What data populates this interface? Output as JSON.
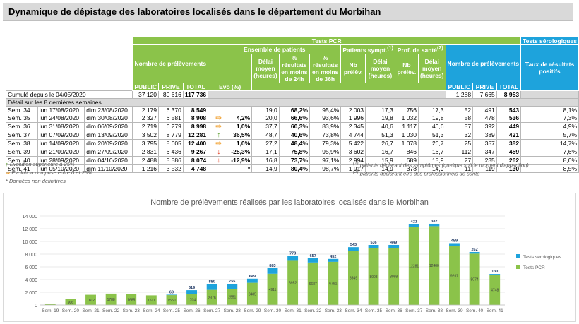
{
  "title": "Dynamique de dépistage des laboratoires localisés dans le département du Morbihan",
  "table": {
    "pcr_header": "Tests PCR",
    "sero_header": "Tests sérologiques",
    "nb_prel": "Nombre de prélèvements",
    "ensemble": "Ensemble de patients",
    "patients_sympt": "Patients sympt.",
    "prof_sante": "Prof. de santé",
    "sup1": "(1)",
    "sup2": "(2)",
    "delai_moyen": "Délai moyen (heures)",
    "pct24": "% résultats en moins de 24h",
    "pct36": "% résultats en moins de 36h",
    "nb_prelev": "Nb prélèv.",
    "taux": "Taux de résultats positifs",
    "public": "PUBLIC",
    "prive": "PRIVE",
    "total": "TOTAL",
    "evo": "Evo (%)",
    "cumul_label": "Cumulé depuis le 04/05/2020",
    "cumul": [
      "37 120",
      "80 616",
      "117 736",
      "1 288",
      "7 665",
      "8 953"
    ],
    "detail_label": "Détail sur les 8 dernières semaines",
    "rows": [
      {
        "sem": "Sem. 34",
        "du": "lun 17/08/2020",
        "au": "dim 23/08/2020",
        "pub": "2 179",
        "priv": "6 370",
        "tot": "8 549",
        "arrow": "",
        "evo": "",
        "delai": "19,0",
        "p24": "68,2%",
        "p36": "95,4%",
        "snb": "2 003",
        "sd": "17,3",
        "pnb": "756",
        "pd": "17,3",
        "spub": "52",
        "spriv": "491",
        "stot": "543",
        "taux": "8,1%"
      },
      {
        "sem": "Sem. 35",
        "du": "lun 24/08/2020",
        "au": "dim 30/08/2020",
        "pub": "2 327",
        "priv": "6 581",
        "tot": "8 908",
        "arrow": "mid",
        "evo": "4,2%",
        "delai": "20,0",
        "p24": "66,6%",
        "p36": "93,6%",
        "snb": "1 996",
        "sd": "19,8",
        "pnb": "1 032",
        "pd": "19,8",
        "spub": "58",
        "spriv": "478",
        "stot": "536",
        "taux": "7,3%"
      },
      {
        "sem": "Sem. 36",
        "du": "lun 31/08/2020",
        "au": "dim 06/09/2020",
        "pub": "2 719",
        "priv": "6 279",
        "tot": "8 998",
        "arrow": "mid",
        "evo": "1,0%",
        "delai": "37,7",
        "p24": "60,3%",
        "p36": "83,9%",
        "snb": "2 345",
        "sd": "40,6",
        "pnb": "1 117",
        "pd": "40,6",
        "spub": "57",
        "spriv": "392",
        "stot": "449",
        "taux": "4,9%"
      },
      {
        "sem": "Sem. 37",
        "du": "lun 07/09/2020",
        "au": "dim 13/09/2020",
        "pub": "3 502",
        "priv": "8 779",
        "tot": "12 281",
        "arrow": "up",
        "evo": "36,5%",
        "delai": "48,7",
        "p24": "40,6%",
        "p36": "73,8%",
        "snb": "4 744",
        "sd": "51,3",
        "pnb": "1 030",
        "pd": "51,3",
        "spub": "32",
        "spriv": "389",
        "stot": "421",
        "taux": "5,7%"
      },
      {
        "sem": "Sem. 38",
        "du": "lun 14/09/2020",
        "au": "dim 20/09/2020",
        "pub": "3 795",
        "priv": "8 605",
        "tot": "12 400",
        "arrow": "mid",
        "evo": "1,0%",
        "delai": "27,2",
        "p24": "48,4%",
        "p36": "79,3%",
        "snb": "5 422",
        "sd": "26,7",
        "pnb": "1 078",
        "pd": "26,7",
        "spub": "25",
        "spriv": "357",
        "stot": "382",
        "taux": "14,7%"
      },
      {
        "sem": "Sem. 39",
        "du": "lun 21/09/2020",
        "au": "dim 27/09/2020",
        "pub": "2 831",
        "priv": "6 436",
        "tot": "9 267",
        "arrow": "dn",
        "evo": "-25,3%",
        "delai": "17,1",
        "p24": "75,8%",
        "p36": "95,9%",
        "snb": "3 602",
        "sd": "16,7",
        "pnb": "846",
        "pd": "16,7",
        "spub": "112",
        "spriv": "347",
        "stot": "459",
        "taux": "7,6%"
      },
      {
        "sem": "Sem. 40",
        "du": "lun 28/09/2020",
        "au": "dim 04/10/2020",
        "pub": "2 488",
        "priv": "5 586",
        "tot": "8 074",
        "arrow": "dn",
        "evo": "-12,9%",
        "delai": "16,8",
        "p24": "73,7%",
        "p36": "97,1%",
        "snb": "2 994",
        "sd": "15,9",
        "pnb": "689",
        "pd": "15,9",
        "spub": "27",
        "spriv": "235",
        "stot": "262",
        "taux": "8,0%"
      },
      {
        "sem": "Sem. 41",
        "du": "lun 05/10/2020",
        "au": "dim 11/10/2020",
        "pub": "1 216",
        "priv": "3 532",
        "tot": "4 748",
        "arrow": "",
        "evo": "*",
        "delai": "14,9",
        "p24": "80,4%",
        "p36": "98,7%",
        "snb": "1 917",
        "sd": "14,9",
        "pnb": "378",
        "pd": "14,9",
        "spub": "11",
        "spriv": "119",
        "stot": "130",
        "taux": "8,5%"
      }
    ]
  },
  "legend": {
    "up": "Evolution supérieure à 25%",
    "mid": "Evolution comprise entre 0 et 25%",
    "note": "* Données non définitives",
    "n1": "patients déclarant des symptômes (quelque soit le moment d'apparition)",
    "n2": "patients déclarant être des professionnels de santé",
    "sup1": "(1)",
    "sup2": "(2)"
  },
  "colors": {
    "pcr": "#8bc34a",
    "sero": "#1ea3dc",
    "up": "#5a9e2c",
    "mid": "#f0a030",
    "down": "#e03a1e"
  },
  "icons": {
    "up": "↑",
    "mid": "⇨",
    "dn": "↓"
  },
  "chart_data": {
    "type": "bar",
    "stacked": true,
    "title": "Nombre de prélèvements réalisés par les laboratoires localisés dans le Morbihan",
    "categories": [
      "Sem. 19",
      "Sem. 20",
      "Sem. 21",
      "Sem. 22",
      "Sem. 23",
      "Sem. 24",
      "Sem. 25",
      "Sem. 26",
      "Sem. 27",
      "Sem. 28",
      "Sem. 29",
      "Sem. 30",
      "Sem. 31",
      "Sem. 32",
      "Sem. 33",
      "Sem. 34",
      "Sem. 35",
      "Sem. 36",
      "Sem. 37",
      "Sem. 38",
      "Sem. 39",
      "Sem. 40",
      "Sem. 41"
    ],
    "series": [
      {
        "name": "Tests PCR",
        "values": [
          150,
          906,
          1602,
          1788,
          1685,
          1511,
          1550,
          1704,
          2376,
          2551,
          3485,
          4911,
          6952,
          6687,
          6791,
          8549,
          8908,
          8998,
          12281,
          12400,
          9267,
          8074,
          4748
        ]
      },
      {
        "name": "Tests sérologiques",
        "values": [
          0,
          0,
          0,
          0,
          0,
          0,
          69,
          619,
          880,
          755,
          649,
          883,
          778,
          657,
          452,
          543,
          536,
          449,
          421,
          382,
          459,
          262,
          130
        ]
      }
    ],
    "ylim": [
      0,
      14000
    ],
    "yticks": [
      "0",
      "2 000",
      "4 000",
      "6 000",
      "8 000",
      "10 000",
      "12 000",
      "14 000"
    ],
    "grid": true,
    "legend_position": "right"
  }
}
